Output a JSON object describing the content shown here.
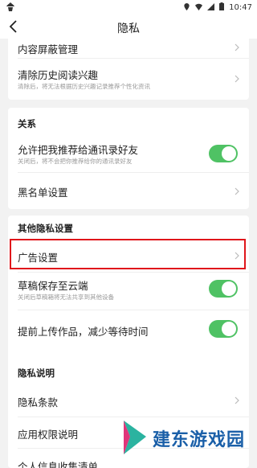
{
  "statusbar": {
    "left_icon": "android-debug-icon",
    "time": "10:47",
    "icons": [
      "location-icon",
      "wifi-icon",
      "signal-icon",
      "battery-icon"
    ]
  },
  "nav": {
    "title": "隐私"
  },
  "section1": {
    "rows": [
      {
        "label": "内容屏蔽管理"
      },
      {
        "label": "清除历史阅读兴趣",
        "sub": "清除后，将无法根据历史兴趣记录推荐个性化资讯"
      }
    ]
  },
  "section2": {
    "title": "关系",
    "rows": [
      {
        "label": "允许把我推荐给通讯录好友",
        "sub": "关闭后，将不会把你推荐给你的通讯录好友",
        "toggle": true
      },
      {
        "label": "黑名单设置"
      }
    ]
  },
  "section3": {
    "title": "其他隐私设置",
    "rows": [
      {
        "label": "广告设置"
      },
      {
        "label": "草稿保存至云端",
        "sub": "关闭后草稿箱将无法共享到其他设备",
        "toggle": true
      },
      {
        "label": "提前上传作品，减少等待时间",
        "toggle": true
      }
    ]
  },
  "section4": {
    "title": "隐私说明",
    "rows": [
      {
        "label": "隐私条款"
      },
      {
        "label": "应用权限说明"
      },
      {
        "label": "个人信息收集清单"
      }
    ]
  },
  "watermark": {
    "text": "建东游戏园"
  },
  "colors": {
    "toggle_on": "#4fc264",
    "highlight": "#e0161b",
    "background": "#f2f2f2"
  }
}
